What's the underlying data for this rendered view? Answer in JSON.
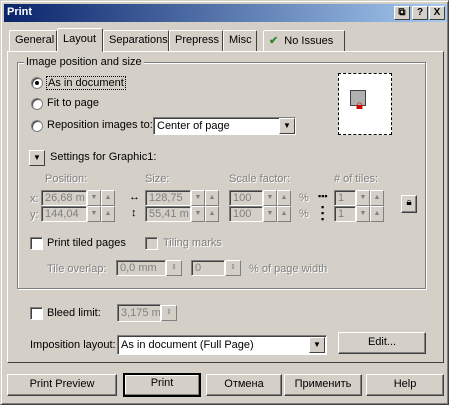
{
  "window": {
    "title": "Print"
  },
  "title_buttons": {
    "help": "?",
    "close": "X",
    "extra": "⧉"
  },
  "tabs": [
    {
      "label": "General"
    },
    {
      "label": "Layout"
    },
    {
      "label": "Separations"
    },
    {
      "label": "Prepress"
    },
    {
      "label": "Misc"
    },
    {
      "label": "No Issues"
    }
  ],
  "position_group": {
    "legend": "Image position and size",
    "opt_as_document": "As in document",
    "opt_fit": "Fit to page",
    "opt_reposition": "Reposition images to:",
    "reposition_value": "Center of page",
    "settings_label": "Settings for Graphic1:"
  },
  "graphic_settings": {
    "position_header": "Position:",
    "size_header": "Size:",
    "scale_header": "Scale factor:",
    "tiles_header": "# of tiles:",
    "x_label": "x:",
    "y_label": "y:",
    "pos_x": "26,68 m",
    "pos_y": "144,04",
    "size_w": "128,75",
    "size_h": "55,41 m",
    "scale_x": "100",
    "scale_y": "100",
    "pct1": "%",
    "pct2": "%",
    "tiles_x": "1",
    "tiles_y": "1"
  },
  "tiling": {
    "print_tiled": "Print tiled pages",
    "tiling_marks": "Tiling marks",
    "tile_overlap_label": "Tile overlap:",
    "tile_overlap_value": "0,0 mm",
    "tile_pct_value": "0",
    "tile_pct_label": "% of page width"
  },
  "bleed": {
    "label": "Bleed limit:",
    "value": "3,175 m"
  },
  "imposition": {
    "label": "Imposition layout:",
    "value": "As in document (Full Page)",
    "edit": "Edit..."
  },
  "footer": {
    "print_preview": "Print Preview",
    "print": "Print",
    "cancel": "Отмена",
    "apply": "Применить",
    "help": "Help"
  }
}
